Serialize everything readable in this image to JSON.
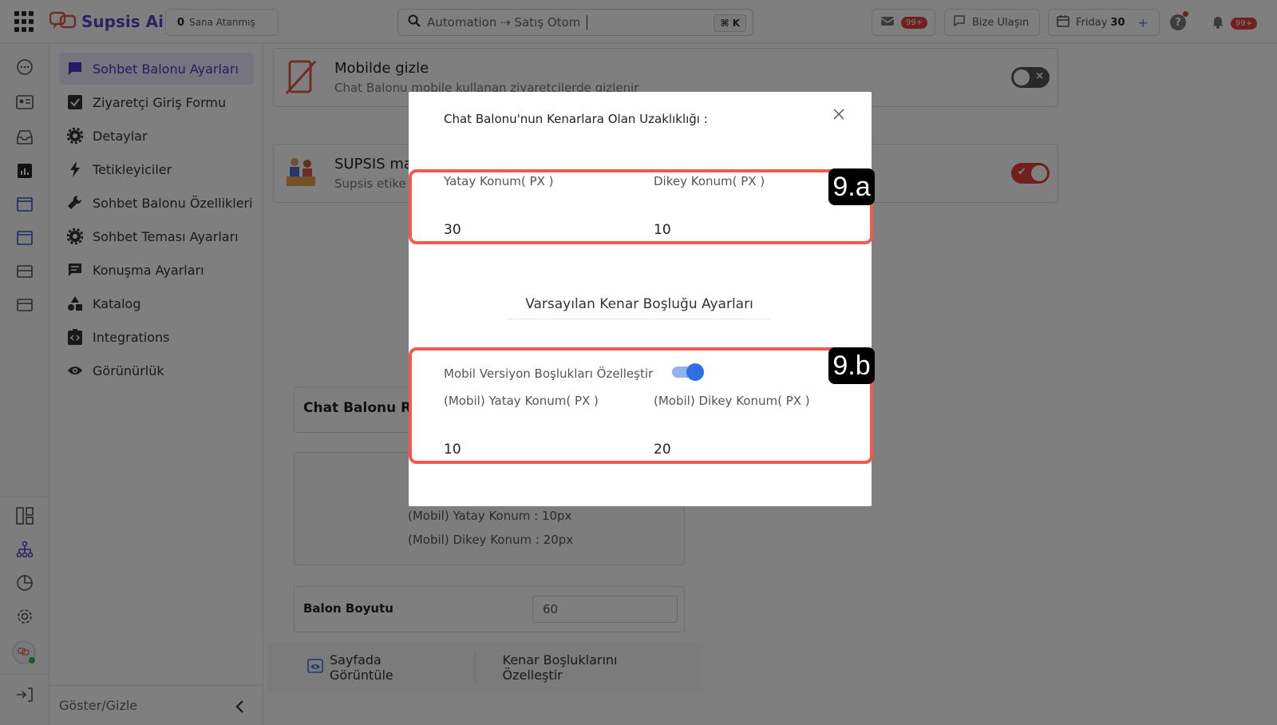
{
  "topbar": {
    "brand": "Supsis Ai",
    "assign_count": "0",
    "assign_label": "Sana Atanmış",
    "search_value": "Automation ⇢ Satış Otom",
    "search_shortcut": "⌘ K",
    "mail_badge": "99+",
    "contact_label": "Bize Ulaşın",
    "date_day": "Friday",
    "date_num": "30",
    "notif_badge": "99+"
  },
  "menu": {
    "items": [
      {
        "label": "Sohbet Balonu Ayarları"
      },
      {
        "label": "Ziyaretçi Giriş Formu"
      },
      {
        "label": "Detaylar"
      },
      {
        "label": "Tetikleyiciler"
      },
      {
        "label": "Sohbet Balonu Özellikleri"
      },
      {
        "label": "Sohbet Teması Ayarları"
      },
      {
        "label": "Konuşma Ayarları"
      },
      {
        "label": "Katalog"
      },
      {
        "label": "Integrations"
      },
      {
        "label": "Görünürlük"
      }
    ],
    "footer": "Göster/Gizle"
  },
  "main": {
    "mobile_hide_title": "Mobilde gizle",
    "mobile_hide_sub": "Chat Balonu mobile kullanan ziyaretçilerde gizlenir",
    "supsis_title": "SUPSIS ma",
    "supsis_sub": "Supsis etike",
    "bubble_pos_title": "Chat Balonu Re",
    "preview_line1": "(Mobil) Yatay Konum : 10px",
    "preview_line2": "(Mobil) Dikey Konum : 20px",
    "balloon_size_label": "Balon Boyutu",
    "balloon_size_value": "60",
    "view_on_page": "Sayfada Görüntüle",
    "customize_margins": "Kenar Boşluklarını Özelleştir"
  },
  "modal": {
    "title": "Chat Balonu'nun Kenarlara Olan Uzaklıklığı :",
    "horizontal_label": "Yatay Konum( PX )",
    "horizontal_value": "30",
    "vertical_label": "Dikey Konum( PX )",
    "vertical_value": "10",
    "tag_a": "9.a",
    "section_title": "Varsayılan Kenar Boşluğu Ayarları",
    "mobile_customize_label": "Mobil Versiyon Boşlukları Özelleştir",
    "mobile_horizontal_label": "(Mobil) Yatay Konum( PX )",
    "mobile_horizontal_value": "10",
    "mobile_vertical_label": "(Mobil) Dikey Konum( PX )",
    "mobile_vertical_value": "20",
    "tag_b": "9.b"
  },
  "colors": {
    "brand": "#5a45c8",
    "highlight": "#f25a50",
    "toggle_on": "#e2403c",
    "switch_blue": "#2f6fe4"
  }
}
